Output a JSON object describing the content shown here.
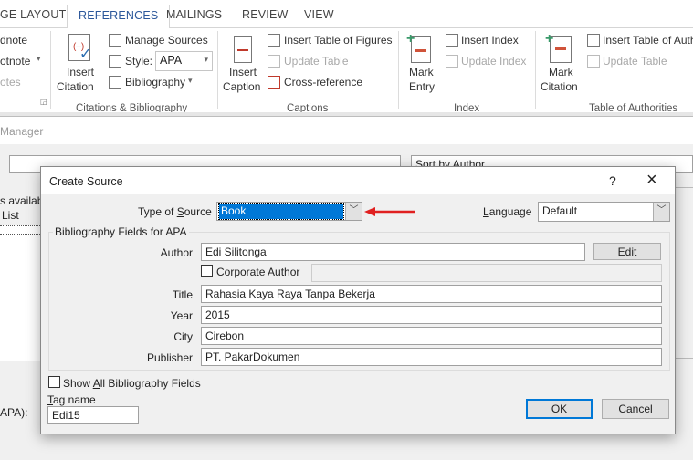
{
  "ribbon": {
    "tabs": [
      "GE LAYOUT",
      "REFERENCES",
      "MAILINGS",
      "REVIEW",
      "VIEW"
    ],
    "active_tab": "REFERENCES",
    "footnotes": {
      "items": [
        "dnote",
        "otnote"
      ],
      "group": "otes"
    },
    "citations": {
      "insert_citation": [
        "Insert",
        "Citation"
      ],
      "manage_sources": "Manage Sources",
      "style_label": "Style:",
      "style_value": "APA",
      "bibliography": "Bibliography",
      "group": "Citations & Bibliography"
    },
    "captions": {
      "insert_caption": [
        "Insert",
        "Caption"
      ],
      "insert_table_of_figures": "Insert Table of Figures",
      "update_table": "Update Table",
      "cross_reference": "Cross-reference",
      "group": "Captions"
    },
    "index": {
      "mark_entry": [
        "Mark",
        "Entry"
      ],
      "insert_index": "Insert Index",
      "update_index": "Update Index",
      "group": "Index"
    },
    "authorities": {
      "mark_citation": [
        "Mark",
        "Citation"
      ],
      "insert_table": "Insert Table of Auth",
      "update_table": "Update Table",
      "group": "Table of Authorities"
    }
  },
  "manager": {
    "title": "Manager",
    "sort": "Sort by Author",
    "available": "s availabl",
    "list": "List",
    "apa_label": "APA):"
  },
  "dialog": {
    "title": "Create Source",
    "help": "?",
    "close": "×",
    "type_label": [
      "Type of ",
      "S",
      "ource"
    ],
    "type_value": "Book",
    "language_label": [
      "L",
      "anguage"
    ],
    "language_value": "Default",
    "group_label": "Bibliography Fields for APA",
    "author_label": "Author",
    "author_value": "Edi Silitonga",
    "edit": "Edit",
    "corporate_label": "Corporate Author",
    "title_label": "Title",
    "title_value": "Rahasia Kaya Raya Tanpa Bekerja",
    "year_label": "Year",
    "year_value": "2015",
    "city_label": "City",
    "city_value": "Cirebon",
    "publisher_label": "Publisher",
    "publisher_value": "PT. PakarDokumen",
    "show_all": [
      "Show ",
      "A",
      "ll Bibliography Fields"
    ],
    "tag_label": [
      "T",
      "ag name"
    ],
    "tag_value": "Edi15",
    "ok": "OK",
    "cancel": "Cancel"
  },
  "colors": {
    "accent": "#2b579a",
    "selection": "#0078d7",
    "arrow": "#e02020",
    "ok_border": "#0078d7"
  }
}
